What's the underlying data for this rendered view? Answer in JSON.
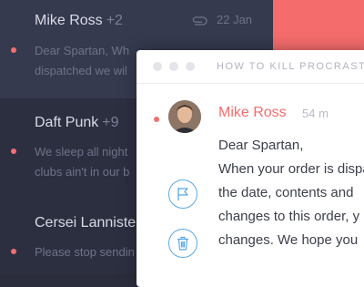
{
  "inbox": {
    "items": [
      {
        "sender": "Mike Ross",
        "count": "+2",
        "date": "22 Jan",
        "preview_lines": [
          "Dear Spartan, Wh",
          "dispatched we wil"
        ]
      },
      {
        "sender": "Daft Punk",
        "count": "+9",
        "preview_lines": [
          "We sleep all night",
          "clubs ain't in our b"
        ]
      },
      {
        "sender": "Cersei Lannister",
        "count": "",
        "preview_lines": [
          "Please stop sendin"
        ]
      }
    ]
  },
  "message": {
    "subject": "HOW TO KILL PROCRASTINATION",
    "from": "Mike Ross",
    "time": "54 m",
    "body_lines": [
      "Dear Spartan,",
      "When your order is dispatched we will",
      "the date, contents and",
      "changes to this order, y",
      "changes. We hope you"
    ]
  },
  "colors": {
    "accent": "#f56c6c",
    "sidebar": "#2c2f40",
    "active_row": "#353a4f",
    "action_blue": "#5aa9e6"
  },
  "icons": [
    "paperclip-icon",
    "flag-icon",
    "trash-icon"
  ]
}
